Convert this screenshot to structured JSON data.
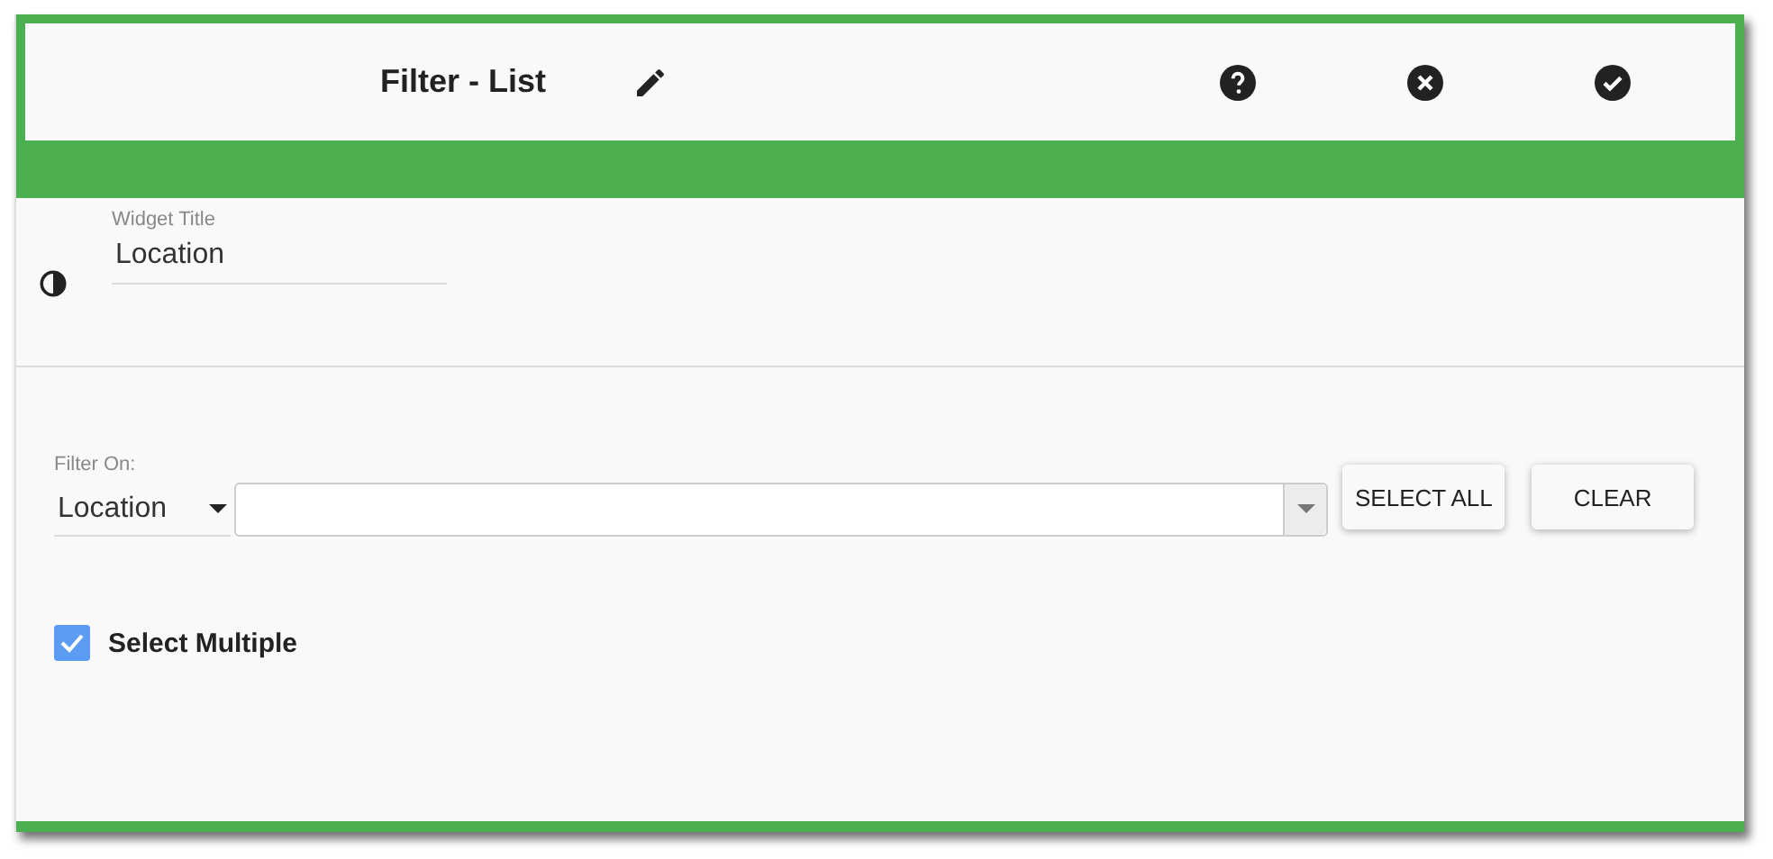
{
  "header": {
    "title": "Filter - List"
  },
  "widget_title": {
    "label": "Widget Title",
    "value": "Location"
  },
  "filter": {
    "label": "Filter On:",
    "field": "Location"
  },
  "buttons": [
    "SELECT ALL",
    "CLEAR"
  ],
  "select_multiple": {
    "label": "Select Multiple",
    "checked": true
  }
}
